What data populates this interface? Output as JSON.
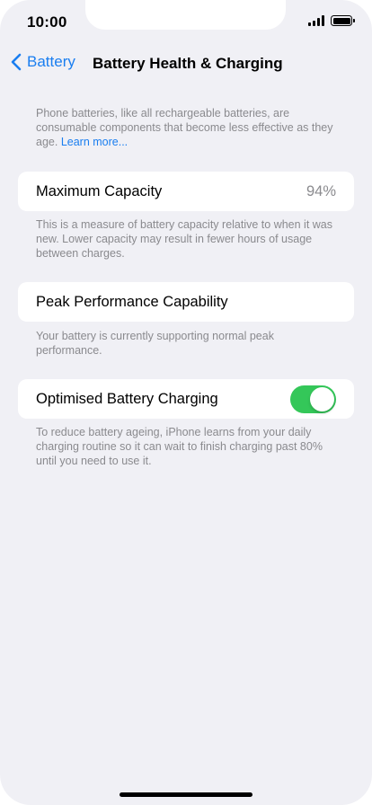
{
  "status_bar": {
    "time": "10:00"
  },
  "nav": {
    "back_label": "Battery",
    "title": "Battery Health & Charging"
  },
  "intro": {
    "text": "Phone batteries, like all rechargeable batteries, are consumable components that become less effective as they age. ",
    "link": "Learn more..."
  },
  "max_capacity": {
    "label": "Maximum Capacity",
    "value": "94%",
    "footnote": "This is a measure of battery capacity relative to when it was new. Lower capacity may result in fewer hours of usage between charges."
  },
  "peak_performance": {
    "label": "Peak Performance Capability",
    "footnote": "Your battery is currently supporting normal peak performance."
  },
  "optimised_charging": {
    "label": "Optimised Battery Charging",
    "enabled": true,
    "footnote": "To reduce battery ageing, iPhone learns from your daily charging routine so it can wait to finish charging past 80% until you need to use it."
  },
  "colors": {
    "accent": "#1a7ef0",
    "toggle_on": "#34c759",
    "background": "#f0f0f5"
  },
  "icons": {
    "back": "chevron-left-icon",
    "signal": "cellular-signal-icon",
    "battery": "battery-icon"
  }
}
